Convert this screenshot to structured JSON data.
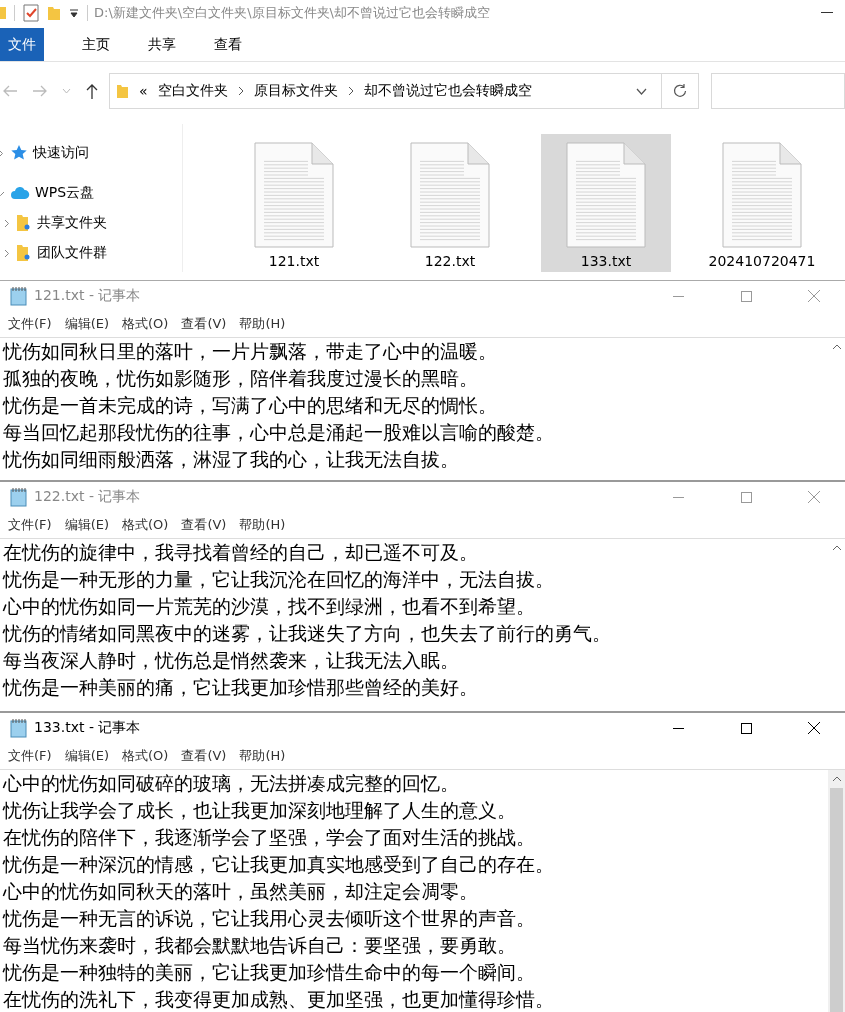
{
  "explorer": {
    "title_path": "D:\\新建文件夹\\空白文件夹\\原目标文件夹\\却不曾说过它也会转瞬成空",
    "ribbon_tabs": [
      {
        "label": "文件",
        "selected": true
      },
      {
        "label": "主页",
        "selected": false
      },
      {
        "label": "共享",
        "selected": false
      },
      {
        "label": "查看",
        "selected": false
      }
    ],
    "address": {
      "overflow": "«",
      "crumbs": [
        "空白文件夹",
        "原目标文件夹",
        "却不曾说过它也会转瞬成空"
      ]
    },
    "nav": [
      {
        "label": "快速访问",
        "kind": "star",
        "expanded": false
      },
      {
        "label": "WPS云盘",
        "kind": "cloud",
        "expanded": true,
        "children": [
          {
            "label": "共享文件夹",
            "kind": "folder",
            "expanded": false
          },
          {
            "label": "团队文件群",
            "kind": "folder",
            "expanded": false
          }
        ]
      }
    ],
    "files": [
      {
        "name": "121.txt",
        "selected": false
      },
      {
        "name": "122.txt",
        "selected": false
      },
      {
        "name": "133.txt",
        "selected": true
      },
      {
        "name": "202410720471",
        "selected": false
      }
    ]
  },
  "notepads": [
    {
      "title": "121.txt - 记事本",
      "active": false,
      "menu": [
        "文件(F)",
        "编辑(E)",
        "格式(O)",
        "查看(V)",
        "帮助(H)"
      ],
      "lines": [
        "忧伤如同秋日里的落叶，一片片飘落，带走了心中的温暖。",
        "孤独的夜晚，忧伤如影随形，陪伴着我度过漫长的黑暗。",
        "忧伤是一首未完成的诗，写满了心中的思绪和无尽的惆怅。",
        "每当回忆起那段忧伤的往事，心中总是涌起一股难以言喻的酸楚。",
        "忧伤如同细雨般洒落，淋湿了我的心，让我无法自拔。"
      ]
    },
    {
      "title": "122.txt - 记事本",
      "active": false,
      "menu": [
        "文件(F)",
        "编辑(E)",
        "格式(O)",
        "查看(V)",
        "帮助(H)"
      ],
      "lines": [
        "在忧伤的旋律中，我寻找着曾经的自己，却已遥不可及。",
        "忧伤是一种无形的力量，它让我沉沦在回忆的海洋中，无法自拔。",
        "心中的忧伤如同一片荒芜的沙漠，找不到绿洲，也看不到希望。",
        "忧伤的情绪如同黑夜中的迷雾，让我迷失了方向，也失去了前行的勇气。",
        "每当夜深人静时，忧伤总是悄然袭来，让我无法入眠。",
        "忧伤是一种美丽的痛，它让我更加珍惜那些曾经的美好。"
      ]
    },
    {
      "title": "133.txt - 记事本",
      "active": true,
      "menu": [
        "文件(F)",
        "编辑(E)",
        "格式(O)",
        "查看(V)",
        "帮助(H)"
      ],
      "lines": [
        "心中的忧伤如同破碎的玻璃，无法拼凑成完整的回忆。",
        "忧伤让我学会了成长，也让我更加深刻地理解了人生的意义。",
        "在忧伤的陪伴下，我逐渐学会了坚强，学会了面对生活的挑战。",
        "忧伤是一种深沉的情感，它让我更加真实地感受到了自己的存在。",
        "心中的忧伤如同秋天的落叶，虽然美丽，却注定会凋零。",
        "忧伤是一种无言的诉说，它让我用心灵去倾听这个世界的声音。",
        "每当忧伤来袭时，我都会默默地告诉自己：要坚强，要勇敢。",
        "忧伤是一种独特的美丽，它让我更加珍惜生命中的每一个瞬间。",
        "在忧伤的洗礼下，我变得更加成熟、更加坚强，也更加懂得珍惜。"
      ]
    }
  ]
}
